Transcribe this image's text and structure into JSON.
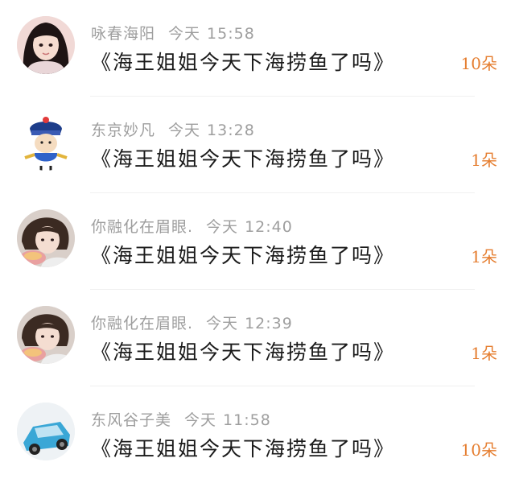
{
  "comments": [
    {
      "name": "咏春海阳",
      "day": "今天",
      "time": "15:58",
      "text": "《海王姐姐今天下海捞鱼了吗》",
      "count": "10朵"
    },
    {
      "name": "东京妙凡",
      "day": "今天",
      "time": "13:28",
      "text": "《海王姐姐今天下海捞鱼了吗》",
      "count": "1朵"
    },
    {
      "name": "你融化在眉眼.",
      "day": "今天",
      "time": "12:40",
      "text": "《海王姐姐今天下海捞鱼了吗》",
      "count": "1朵"
    },
    {
      "name": "你融化在眉眼.",
      "day": "今天",
      "time": "12:39",
      "text": "《海王姐姐今天下海捞鱼了吗》",
      "count": "1朵"
    },
    {
      "name": "东风谷子美",
      "day": "今天",
      "time": "11:58",
      "text": "《海王姐姐今天下海捞鱼了吗》",
      "count": "10朵"
    }
  ],
  "colors": {
    "meta_gray": "#9e9e9e",
    "count_orange": "#e57d2f",
    "text": "#1a1a1a"
  }
}
